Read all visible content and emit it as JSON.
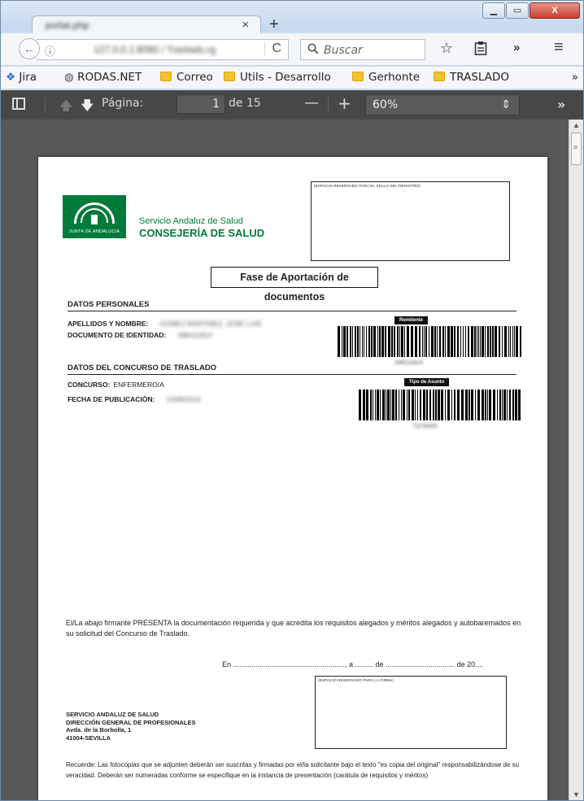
{
  "window": {
    "tab_title": "portal.php",
    "tab_close": "×",
    "new_tab": "+",
    "min": "▁",
    "max": "▭",
    "close": "X"
  },
  "nav": {
    "back": "←",
    "info": "ⓘ",
    "url": "127.0.0.1:8080 / Traslado.rg",
    "reload": "C",
    "search_icon": "🔍",
    "search_placeholder": "Buscar",
    "bookmark_star": "☆",
    "reading_list": "📋",
    "more": "»",
    "menu": "≡"
  },
  "bookmarks": {
    "items": [
      {
        "label": "Jira",
        "icon": "jira-icon"
      },
      {
        "label": "RODAS.NET",
        "icon": "globe-icon"
      },
      {
        "label": "Correo",
        "icon": "folder-icon"
      },
      {
        "label": "Utils - Desarrollo",
        "icon": "folder-icon"
      },
      {
        "label": "Gerhonte",
        "icon": "folder-icon"
      },
      {
        "label": "TRASLADO",
        "icon": "folder-icon"
      }
    ],
    "more": "»"
  },
  "pdf_toolbar": {
    "page_label": "Página:",
    "page_value": "1",
    "page_total": "de 15",
    "zoom_out": "—",
    "zoom_in": "+",
    "zoom_value": "60%",
    "zoom_caret": "⇕",
    "tools_more": "»"
  },
  "document": {
    "logo_caption": "JUNTA DE ANDALUCIA",
    "org_line1": "Servicio Andaluz de Salud",
    "org_line2": "CONSEJERÍA DE SALUD",
    "sello_caption": "(ESPACIO RESERVADO PARA EL SELLO DEL REGISTRO)",
    "title": "Fase de Aportación de documentos",
    "sec_personal": "DATOS PERSONALES",
    "label_apellidos": "APELLIDOS Y NOMBRE:",
    "val_apellidos": "GOMEZ MARTINEZ, JOSE LUIS",
    "label_documento": "DOCUMENTO DE IDENTIDAD:",
    "val_documento": "28821181X",
    "tag_remitente": "Remitente",
    "barcode1_num": "28821181X",
    "sec_concurso": "DATOS DEL CONCURSO DE TRASLADO",
    "label_concurso": "CONCURSO:",
    "val_concurso": "ENFERMERO/A",
    "label_fecha": "FECHA DE PUBLICACIÓN:",
    "val_fecha": "13/08/2014",
    "tag_asunto": "Tipo de Asunto",
    "barcode2_num": "711TA001",
    "statement": "El/La abajo firmante PRESENTA la documentación requerida y que acredita los requisitos alegados y méritos alegados y autobaremados en su solicitud del Concurso de Traslado.",
    "fecha_line": "En ......................................................., a ......... de .................................. de 20....",
    "firma_caption": "(ESPACIO RESERVADO PARA LA FIRMA)",
    "addr1": "SERVICIO ANDALUZ DE SALUD",
    "addr2": "DIRECCIÓN GENERAL DE PROFESIONALES",
    "addr3": "Avda. de la Borbolla, 1",
    "addr4": "41004-SEVILLA",
    "recuerde": "Recuerde: Las fotocopias que se adjunten deberán ser suscritas y firmadas por el/la solicitante bajo el texto \"es copia del original\" responsabilizándose de su veracidad. Deberán ser numeradas conforme se especifique en la instancia de presentación (carátula de requisitos y méritos)"
  }
}
